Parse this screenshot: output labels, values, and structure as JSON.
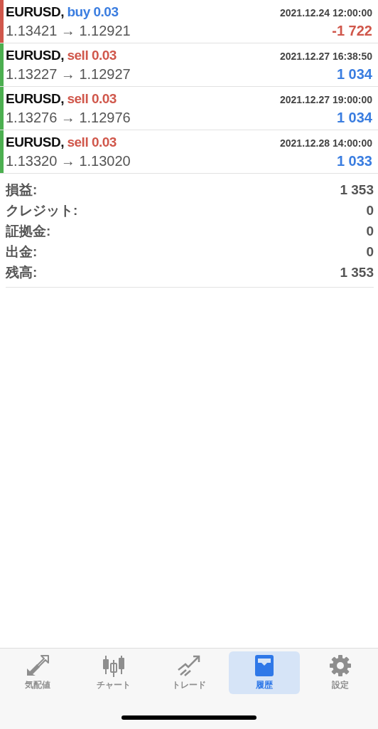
{
  "deals": [
    {
      "symbol": "EURUSD,",
      "kind": "buy",
      "volume": "buy 0.03",
      "time": "2021.12.24 12:00:00",
      "prices": "1.13421 → 1.12921",
      "profit": "-1 722",
      "loss": true,
      "color": "#d0574b"
    },
    {
      "symbol": "EURUSD,",
      "kind": "sell",
      "volume": "sell 0.03",
      "time": "2021.12.27 16:38:50",
      "prices": "1.13227 → 1.12927",
      "profit": "1 034",
      "loss": false,
      "color": "#4caf50"
    },
    {
      "symbol": "EURUSD,",
      "kind": "sell",
      "volume": "sell 0.03",
      "time": "2021.12.27 19:00:00",
      "prices": "1.13276 → 1.12976",
      "profit": "1 034",
      "loss": false,
      "color": "#4caf50"
    },
    {
      "symbol": "EURUSD,",
      "kind": "sell",
      "volume": "sell 0.03",
      "time": "2021.12.28 14:00:00",
      "prices": "1.13320 → 1.13020",
      "profit": "1 033",
      "loss": false,
      "color": "#4caf50"
    }
  ],
  "summary": [
    {
      "label": "損益:",
      "value": "1 353"
    },
    {
      "label": "クレジット:",
      "value": "0"
    },
    {
      "label": "証拠金:",
      "value": "0"
    },
    {
      "label": "出金:",
      "value": "0"
    },
    {
      "label": "残高:",
      "value": "1 353"
    }
  ],
  "tabs": [
    {
      "kind": "quotes",
      "label": "気配値",
      "selected": false
    },
    {
      "kind": "chart",
      "label": "チャート",
      "selected": false
    },
    {
      "kind": "trade",
      "label": "トレード",
      "selected": false
    },
    {
      "kind": "history",
      "label": "履歴",
      "selected": true
    },
    {
      "kind": "settings",
      "label": "設定",
      "selected": false
    }
  ]
}
